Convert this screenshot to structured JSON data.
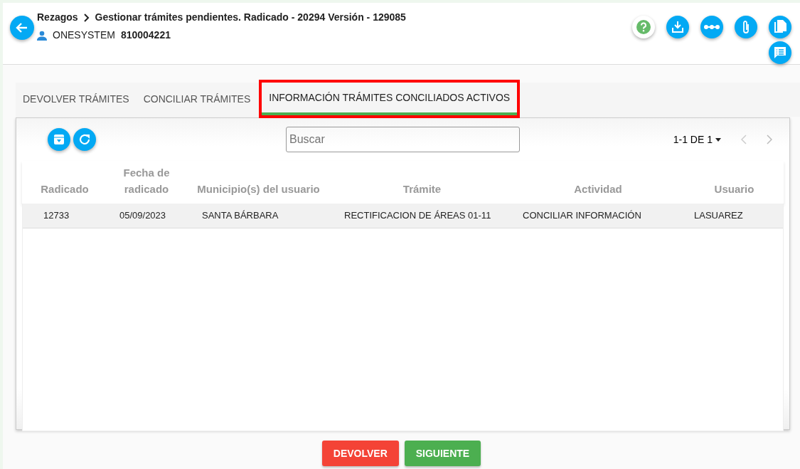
{
  "header": {
    "breadcrumb": [
      "Rezagos",
      "Gestionar trámites pendientes. Radicado - 20294 Versión - 129085"
    ],
    "user_name": "ONESYSTEM",
    "user_id": "810004221"
  },
  "tabs": [
    {
      "label": "DEVOLVER TRÁMITES",
      "selected": false,
      "highlighted": false
    },
    {
      "label": "CONCILIAR TRÁMITES",
      "selected": false,
      "highlighted": false
    },
    {
      "label": "INFORMACIÓN TRÁMITES CONCILIADOS ACTIVOS",
      "selected": true,
      "highlighted": true
    }
  ],
  "search": {
    "placeholder": "Buscar"
  },
  "pagination": "1-1 DE 1",
  "table": {
    "columns": [
      "Radicado",
      "Fecha de radicado",
      "Municipio(s) del usuario",
      "Trámite",
      "Actividad",
      "Usuario"
    ],
    "rows": [
      {
        "cells": [
          "12733",
          "05/09/2023",
          "SANTA BÁRBARA",
          "RECTIFICACION DE ÁREAS 01-11",
          "CONCILIAR INFORMACIÓN",
          "LASUAREZ"
        ],
        "selected": true
      }
    ]
  },
  "buttons": [
    {
      "label": "DEVOLVER",
      "kind": "danger"
    },
    {
      "label": "SIGUIENTE",
      "kind": "success"
    }
  ]
}
